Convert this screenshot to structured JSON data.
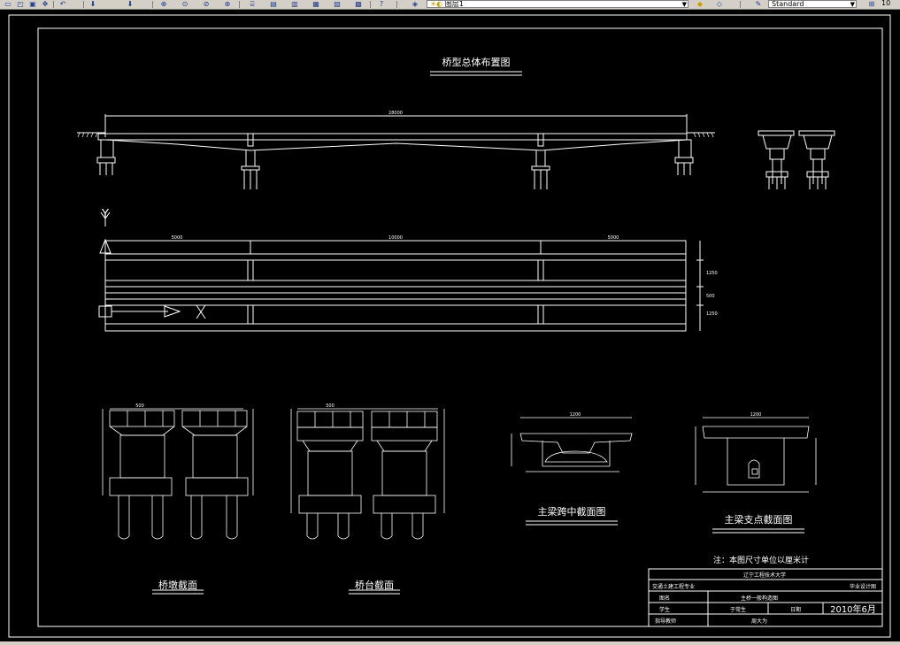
{
  "toolbar": {
    "layer_combo": "图层1",
    "style_combo": "Standard",
    "zoom_value": "10"
  },
  "drawing": {
    "main_title": "桥型总体布置图",
    "total_length": "28000",
    "span_left": "5000",
    "span_mid": "10000",
    "span_right": "5000",
    "width_top": "1250",
    "width_mid": "500",
    "width_bot": "1250",
    "ucs_y": "Y",
    "ucs_x": "X",
    "pier_section_title": "桥墩截面",
    "abutment_section_title": "桥台截面",
    "girder_mid_title": "主梁跨中截面图",
    "girder_support_title": "主梁支点截面图",
    "pier_width": "500",
    "abutment_width": "500",
    "girder_mid_width": "1200",
    "girder_support_width": "1200",
    "note": "注：本图尺寸单位以厘米计"
  },
  "title_block": {
    "university": "辽宁工程技术大学",
    "major": "交通土建工程专业",
    "design_type": "毕业设计图",
    "drawing_name_label": "图名",
    "drawing_name": "主桥一般构造图",
    "student_label": "学生",
    "student": "于常生",
    "date_label": "日期",
    "date": "2010年6月",
    "advisor_label": "指导教师",
    "advisor": "周大为"
  }
}
